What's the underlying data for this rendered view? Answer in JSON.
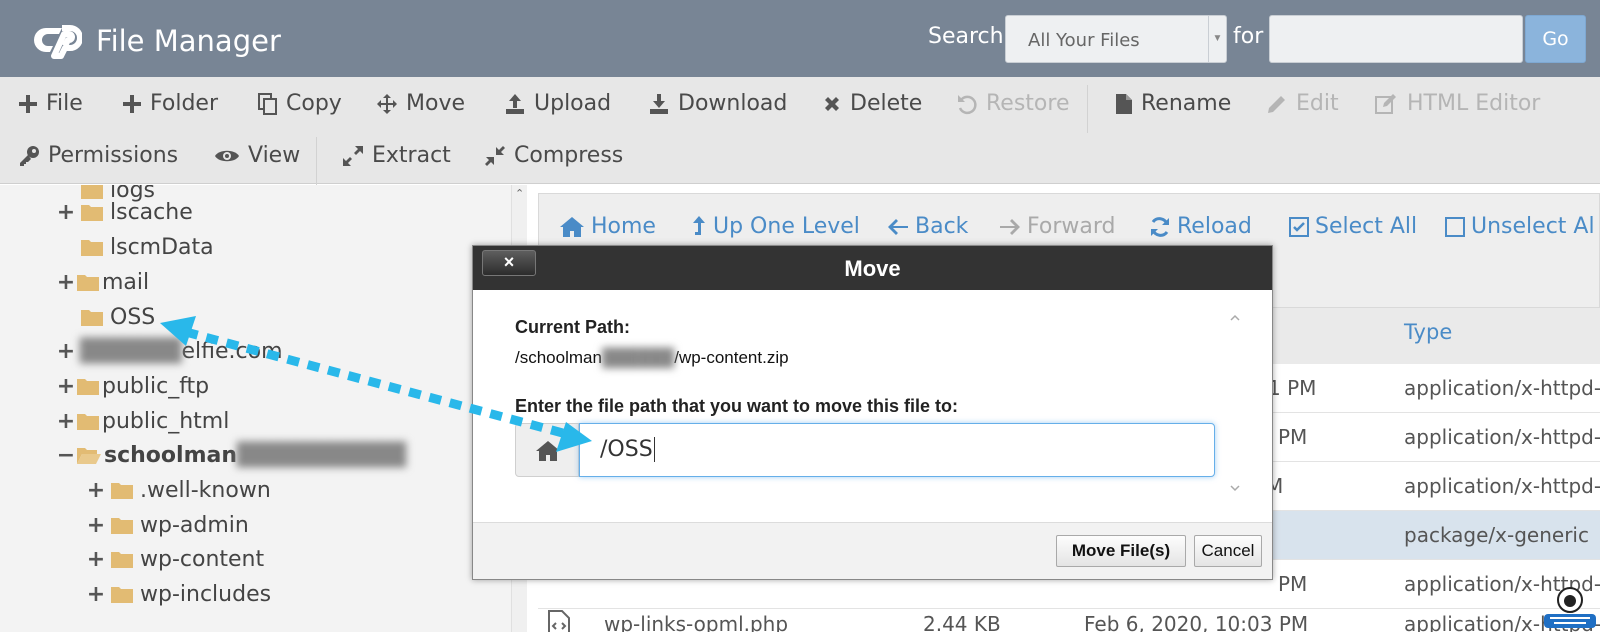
{
  "header": {
    "app_title": "File Manager",
    "search_label": "Search",
    "search_scope": "All Your Files",
    "for_label": "for",
    "search_value": "",
    "go_label": "Go"
  },
  "toolbar": {
    "file": "File",
    "folder": "Folder",
    "copy": "Copy",
    "move": "Move",
    "upload": "Upload",
    "download": "Download",
    "delete": "Delete",
    "restore": "Restore",
    "rename": "Rename",
    "edit": "Edit",
    "html_editor": "HTML Editor",
    "permissions": "Permissions",
    "view": "View",
    "extract": "Extract",
    "compress": "Compress"
  },
  "tree": {
    "items": [
      {
        "label": "logs"
      },
      {
        "label": "lscache"
      },
      {
        "label": "lscmData"
      },
      {
        "label": "mail"
      },
      {
        "label": "OSS"
      },
      {
        "label": "elfie.com"
      },
      {
        "label": "public_ftp"
      },
      {
        "label": "public_html"
      },
      {
        "label": "schoolman"
      },
      {
        "label": ".well-known"
      },
      {
        "label": "wp-admin"
      },
      {
        "label": "wp-content"
      },
      {
        "label": "wp-includes"
      }
    ]
  },
  "nav": {
    "home": "Home",
    "up_one_level": "Up One Level",
    "back": "Back",
    "forward": "Forward",
    "reload": "Reload",
    "select_all": "Select All",
    "unselect_all": "Unselect Al"
  },
  "files": {
    "type_header": "Type",
    "rows": [
      {
        "time": "1 PM",
        "type": "application/x-httpd-p"
      },
      {
        "time": "PM",
        "type": "application/x-httpd-p"
      },
      {
        "time": "PM",
        "type": "application/x-httpd-p"
      },
      {
        "time": "",
        "type": "package/x-generic"
      },
      {
        "time": "PM",
        "type": "application/x-httpd-p"
      },
      {
        "name": "wp-links-opml.php",
        "size": "2.44 KB",
        "time": "Feb 6, 2020, 10:03 PM",
        "type": "application/x-httpd-"
      }
    ]
  },
  "modal": {
    "title": "Move",
    "close_label": "×",
    "current_path_label": "Current Path:",
    "current_path_start": "/schoolman",
    "current_path_end": "/wp-content.zip",
    "enter_label": "Enter the file path that you want to move this file to:",
    "path_value": "/OSS",
    "move_button": "Move File(s)",
    "cancel_button": "Cancel"
  }
}
